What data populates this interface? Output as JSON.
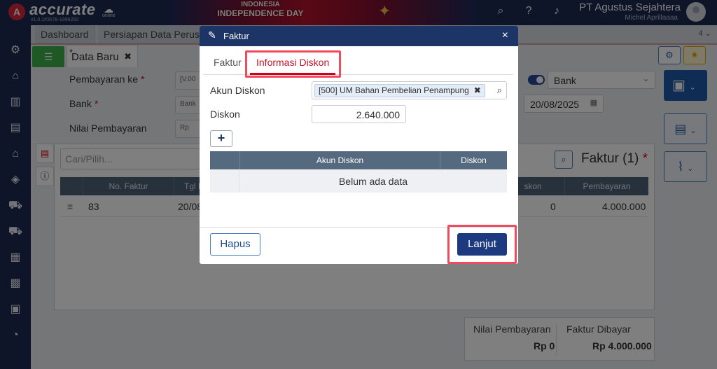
{
  "topbar": {
    "brand": "accurate",
    "brand_sub": "online",
    "version": "v1.0.1#3078-1998293",
    "event_line1": "INDONESIA",
    "event_line2": "INDEPENDENCE DAY",
    "company": "PT Agustus Sejahtera",
    "user": "Michel Aprillaaaa"
  },
  "tabs": {
    "items": [
      {
        "label": "Dashboard"
      },
      {
        "label": "Persiapan Data Perusa"
      }
    ],
    "count": "4"
  },
  "document": {
    "tab_label": "Data Baru",
    "modified_mark": "*",
    "close_glyph": "✖"
  },
  "form": {
    "pembayaran_label": "Pembayaran ke",
    "pembayaran_value": "[V.00",
    "bank_label": "Bank",
    "bank_value": "Bank",
    "nilai_label": "Nilai Pembayaran",
    "nilai_prefix": "Rp",
    "required_mark": "*",
    "type_select": "Bank",
    "date": "20/08/2025"
  },
  "panel": {
    "search_placeholder": "Cari/Pilih...",
    "title": "Faktur (1)",
    "required_mark": "*",
    "columns": [
      "No. Faktur",
      "Tgl F",
      "skon",
      "Pembayaran"
    ],
    "rows": [
      {
        "no": "83",
        "tgl": "20/08",
        "diskon": "0",
        "pembayaran": "4.000.000"
      }
    ]
  },
  "summary": {
    "nilai_label": "Nilai Pembayaran",
    "nilai_value": "Rp 0",
    "dibayar_label": "Faktur Dibayar",
    "dibayar_value": "Rp 4.000.000"
  },
  "modal": {
    "title": "Faktur",
    "close_glyph": "×",
    "tabs": [
      {
        "label": "Faktur"
      },
      {
        "label": "Informasi Diskon"
      }
    ],
    "akun_diskon_label": "Akun Diskon",
    "akun_diskon_chip": "[500] UM Bahan Pembelian Penampung",
    "diskon_label": "Diskon",
    "diskon_value": "2.640.000",
    "add_glyph": "+",
    "table_columns": [
      "Akun Diskon",
      "Diskon"
    ],
    "empty_text": "Belum ada data",
    "delete_label": "Hapus",
    "next_label": "Lanjut"
  },
  "colors": {
    "navy": "#1d2a52",
    "accent_red": "#d0021b",
    "highlight": "#ef4b5c",
    "primary_button": "#1d3a80",
    "green": "#3db34a"
  }
}
